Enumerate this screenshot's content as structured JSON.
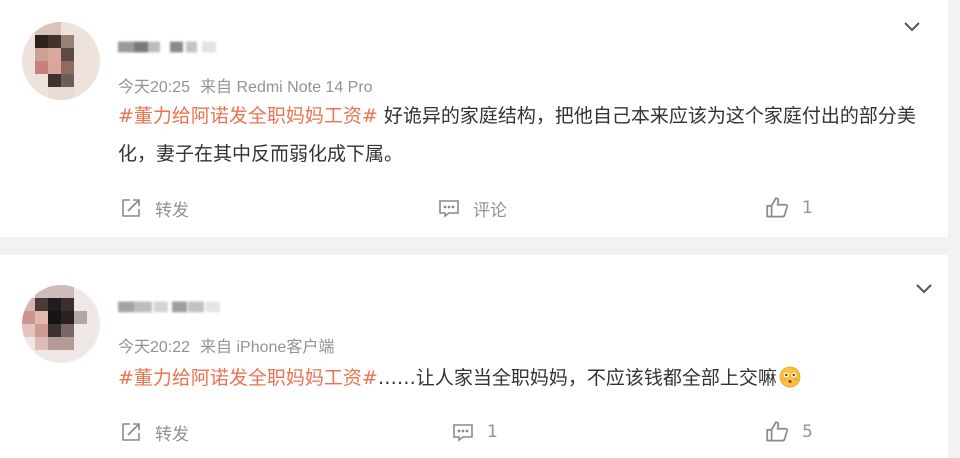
{
  "comments": [
    {
      "time": "今天20:25",
      "source": "来自 Redmi Note 14 Pro",
      "hashtag": "#董力给阿诺发全职妈妈工资#",
      "text": " 好诡异的家庭结构，把他自己本来应该为这个家庭付出的部分美化，妻子在其中反而弱化成下属。",
      "actions": {
        "repost": "转发",
        "comment": "评论",
        "likes": "1"
      },
      "emoji": ""
    },
    {
      "time": "今天20:22",
      "source": "来自 iPhone客户端",
      "hashtag": "#董力给阿诺发全职妈妈工资#",
      "text": "……让人家当全职妈妈，不应该钱都全部上交嘛",
      "actions": {
        "repost": "转发",
        "comment": "1",
        "likes": "5"
      },
      "emoji": "flushed-face"
    }
  ],
  "colors": {
    "hashtag": "#eb7350",
    "meta": "#939393",
    "text": "#333333",
    "divider": "#f2f2f2"
  }
}
